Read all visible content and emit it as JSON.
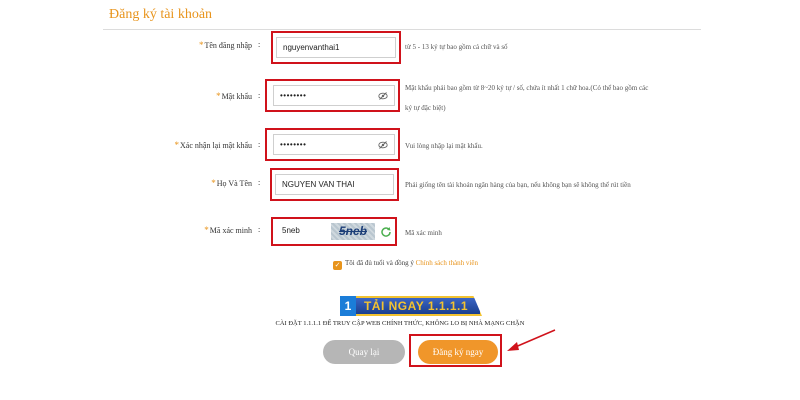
{
  "form": {
    "title": "Đăng ký tài khoản",
    "fields": {
      "username": {
        "label": "Tên đăng nhập",
        "value": "nguyenvanthai1",
        "hint": "từ 5 - 13 ký tự bao gồm cả chữ và số"
      },
      "password": {
        "label": "Mật khẩu",
        "value": "••••••••",
        "hint_line1": "Mật khẩu phải bao gồm từ 8~20 ký tự / số, chứa ít nhất 1 chữ hoa.(Có thể bao gồm các",
        "hint_line2": "ký tự đặc biệt)"
      },
      "confirm_password": {
        "label": "Xác nhận lại mật khẩu",
        "value": "••••••••",
        "hint": "Vui lòng nhập lại mật khẩu."
      },
      "full_name": {
        "label": "Họ Và Tên",
        "value": "NGUYEN VAN THAI",
        "hint": "Phải giống tên tài khoản ngân hàng của bạn, nếu không bạn sẽ không thể rút tiền"
      },
      "captcha": {
        "label": "Mã xác minh",
        "value": "5neb",
        "image_text": "5neb",
        "hint": "Mã xác minh"
      }
    },
    "agree": {
      "text": "Tôi đã đủ tuổi và đồng ý",
      "link": "Chính sách thành viên",
      "checked": true
    },
    "banner": {
      "logo": "1",
      "text": "TẢI NGAY 1.1.1.1"
    },
    "install_note": "CÀI ĐẶT 1.1.1.1 ĐỂ TRUY CẬP WEB CHÍNH THỨC, KHÔNG LO BỊ NHÀ MẠNG CHẶN",
    "buttons": {
      "back": "Quay lại",
      "submit": "Đăng ký ngay"
    }
  },
  "colors": {
    "accent": "#e8941c",
    "highlight": "#d0121b",
    "submit": "#f0962a",
    "back": "#b6b6b6"
  }
}
